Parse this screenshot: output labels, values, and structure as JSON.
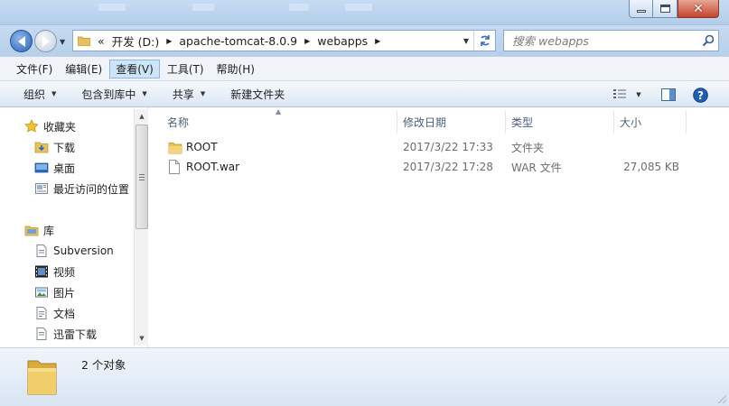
{
  "address_bar": {
    "overflow": "«",
    "crumbs": [
      "开发 (D:)",
      "apache-tomcat-8.0.9",
      "webapps"
    ]
  },
  "search": {
    "placeholder": "搜索 webapps"
  },
  "menu": [
    "文件(F)",
    "编辑(E)",
    "查看(V)",
    "工具(T)",
    "帮助(H)"
  ],
  "menu_active_index": 2,
  "commands": {
    "organize": "组织",
    "include_in_library": "包含到库中",
    "share": "共享",
    "new_folder": "新建文件夹"
  },
  "nav": {
    "favorites": {
      "label": "收藏夹",
      "items": [
        "下载",
        "桌面",
        "最近访问的位置"
      ]
    },
    "libraries": {
      "label": "库",
      "items": [
        "Subversion",
        "视频",
        "图片",
        "文档",
        "迅雷下载"
      ]
    }
  },
  "columns": {
    "name": "名称",
    "modified": "修改日期",
    "type": "类型",
    "size": "大小"
  },
  "files": [
    {
      "name": "ROOT",
      "modified": "2017/3/22 17:33",
      "type": "文件夹",
      "size": "",
      "icon": "folder-icon"
    },
    {
      "name": "ROOT.war",
      "modified": "2017/3/22 17:28",
      "type": "WAR 文件",
      "size": "27,085 KB",
      "icon": "file-icon"
    }
  ],
  "status": {
    "count": "2 个对象"
  },
  "colors": {
    "titlebar": "#c6dcf3",
    "menu_active": "#cde4f9",
    "folder": "#e8c15a",
    "close_button": "#c3442c"
  }
}
